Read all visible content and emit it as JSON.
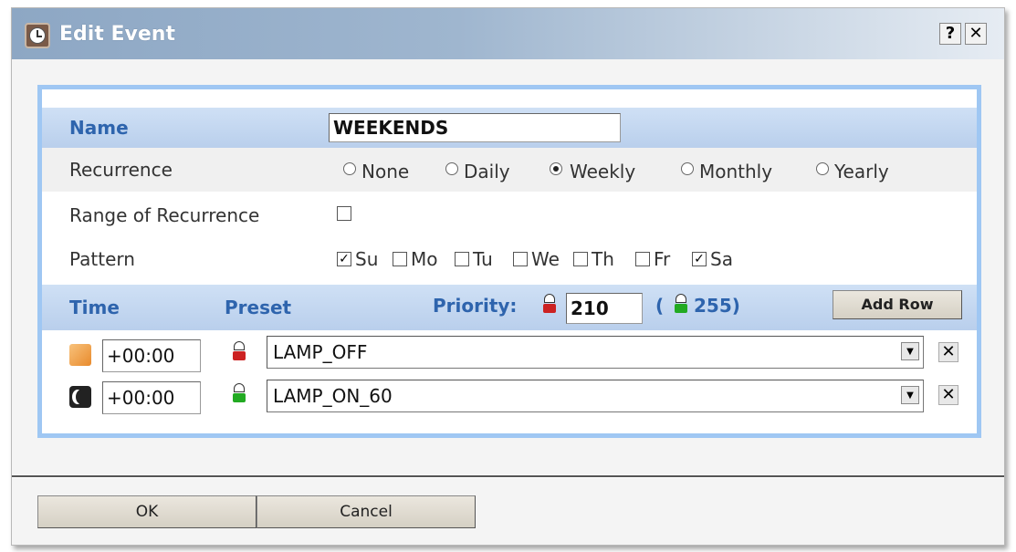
{
  "dialog": {
    "title": "Edit Event",
    "help_label": "?",
    "close_label": "✕"
  },
  "form": {
    "name_label": "Name",
    "name_value": "WEEKENDS",
    "recurrence_label": "Recurrence",
    "recurrence_options": [
      "None",
      "Daily",
      "Weekly",
      "Monthly",
      "Yearly"
    ],
    "recurrence_selected": "Weekly",
    "range_label": "Range of Recurrence",
    "range_checked": false,
    "pattern_label": "Pattern",
    "pattern_days": [
      {
        "label": "Su",
        "checked": true
      },
      {
        "label": "Mo",
        "checked": false
      },
      {
        "label": "Tu",
        "checked": false
      },
      {
        "label": "We",
        "checked": false
      },
      {
        "label": "Th",
        "checked": false
      },
      {
        "label": "Fr",
        "checked": false
      },
      {
        "label": "Sa",
        "checked": true
      }
    ]
  },
  "schedule": {
    "time_header": "Time",
    "preset_header": "Preset",
    "priority_label": "Priority:",
    "priority_value": "210",
    "priority_max_open": "(",
    "priority_max": "255)",
    "add_row_label": "Add Row",
    "rows": [
      {
        "time_icon": "sunrise-icon",
        "time": "+00:00",
        "preset_icon_color": "#cc2222",
        "preset": "LAMP_OFF"
      },
      {
        "time_icon": "moon-icon",
        "time": "+00:00",
        "preset_icon_color": "#22aa22",
        "preset": "LAMP_ON_60"
      }
    ]
  },
  "footer": {
    "ok_label": "OK",
    "cancel_label": "Cancel"
  },
  "colors": {
    "accent_blue": "#2e64ad",
    "panel_border": "#9fc7f3",
    "header_row": "#c4d7ef"
  }
}
